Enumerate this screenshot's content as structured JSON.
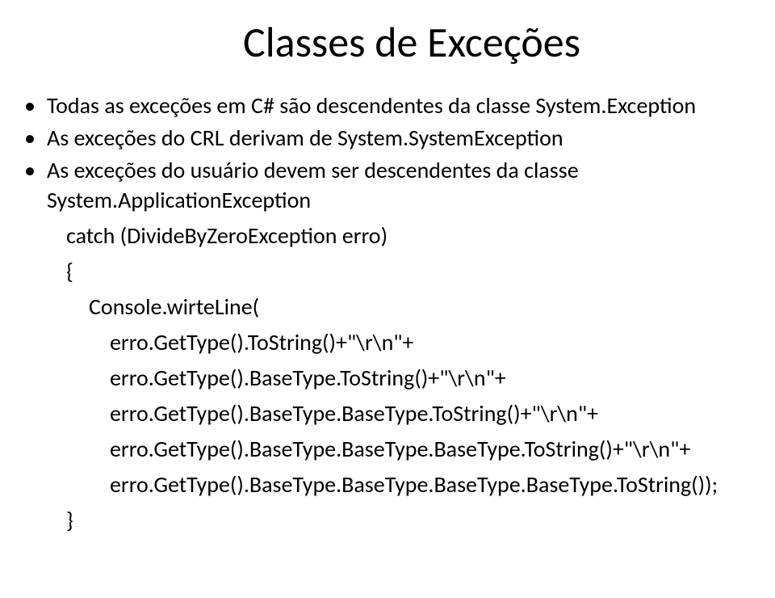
{
  "title": "Classes de Exceções",
  "bullets": [
    "Todas as exceções em C# são descendentes da classe System.Exception",
    "As exceções do CRL derivam de System.SystemException",
    "As exceções do usuário devem ser descendentes da classe System.ApplicationException"
  ],
  "code": {
    "line1": "catch (DivideByZeroException erro)",
    "line2": "{",
    "line3": "Console.wirteLine(",
    "line4": "erro.GetType().ToString()+\"\\r\\n\"+",
    "line5": "erro.GetType().BaseType.ToString()+\"\\r\\n\"+",
    "line6": "erro.GetType().BaseType.BaseType.ToString()+\"\\r\\n\"+",
    "line7": "erro.GetType().BaseType.BaseType.BaseType.ToString()+\"\\r\\n\"+",
    "line8": "erro.GetType().BaseType.BaseType.BaseType.BaseType.ToString());",
    "line9": "}"
  }
}
